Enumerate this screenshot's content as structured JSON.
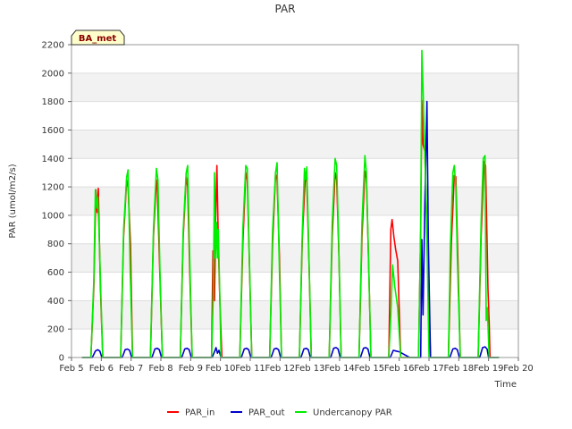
{
  "chart_data": {
    "type": "line",
    "title": "PAR",
    "xlabel": "Time",
    "ylabel": "PAR (umol/m2/s)",
    "badge": "BA_met",
    "xlim": [
      5,
      20
    ],
    "ylim": [
      0,
      2200
    ],
    "x_ticks": [
      5,
      6,
      7,
      8,
      9,
      10,
      11,
      12,
      13,
      14,
      15,
      16,
      17,
      18,
      19,
      20
    ],
    "x_tick_labels": [
      "Feb 5",
      "Feb 6",
      "Feb 7",
      "Feb 8",
      "Feb 9",
      "Feb 10",
      "Feb 11",
      "Feb 12",
      "Feb 13",
      "Feb 14",
      "Feb 15",
      "Feb 16",
      "Feb 17",
      "Feb 18",
      "Feb 19",
      "Feb 20"
    ],
    "y_ticks": [
      0,
      200,
      400,
      600,
      800,
      1000,
      1200,
      1400,
      1600,
      1800,
      2000,
      2200
    ],
    "y_tick_labels": [
      "0",
      "200",
      "400",
      "600",
      "800",
      "1000",
      "1200",
      "1400",
      "1600",
      "1800",
      "2000",
      "2200"
    ],
    "grid": true,
    "legend_position": "bottom",
    "series": [
      {
        "name": "PAR_in",
        "color": "#ff0000",
        "x": [
          5.35,
          5.65,
          5.75,
          5.82,
          5.86,
          5.9,
          5.97,
          6.05,
          6.35,
          6.65,
          6.75,
          6.85,
          6.9,
          6.98,
          7.05,
          7.35,
          7.65,
          7.75,
          7.85,
          7.88,
          7.95,
          8.05,
          8.35,
          8.65,
          8.75,
          8.85,
          8.9,
          8.97,
          9.05,
          9.35,
          9.7,
          9.75,
          9.8,
          9.84,
          9.88,
          9.93,
          9.98,
          10.05,
          10.35,
          10.65,
          10.75,
          10.85,
          10.9,
          10.98,
          11.05,
          11.35,
          11.65,
          11.75,
          11.85,
          11.9,
          11.98,
          12.05,
          12.35,
          12.65,
          12.75,
          12.85,
          12.9,
          12.98,
          13.05,
          13.35,
          13.65,
          13.75,
          13.85,
          13.9,
          13.98,
          14.05,
          14.35,
          14.65,
          14.75,
          14.85,
          14.9,
          14.98,
          15.05,
          15.35,
          15.65,
          15.72,
          15.76,
          15.82,
          15.88,
          15.95,
          16.05,
          16.2,
          16.35,
          16.65,
          16.72,
          16.76,
          16.8,
          16.86,
          16.95,
          17.05,
          17.35,
          17.65,
          17.75,
          17.85,
          17.9,
          17.97,
          18.05,
          18.35,
          18.65,
          18.75,
          18.85,
          18.9,
          18.94,
          18.98,
          19.02,
          19.05,
          19.35
        ],
        "y": [
          0,
          0,
          500,
          1180,
          1020,
          1190,
          500,
          0,
          0,
          0,
          850,
          1250,
          1200,
          800,
          0,
          0,
          0,
          850,
          1250,
          1200,
          700,
          0,
          0,
          0,
          850,
          1270,
          1200,
          600,
          0,
          0,
          0,
          750,
          400,
          1000,
          1350,
          800,
          400,
          0,
          0,
          0,
          800,
          1300,
          1250,
          600,
          0,
          0,
          0,
          800,
          1290,
          1250,
          700,
          0,
          0,
          0,
          850,
          1280,
          1240,
          600,
          0,
          0,
          0,
          850,
          1300,
          1250,
          700,
          0,
          0,
          0,
          850,
          1310,
          1260,
          600,
          0,
          0,
          0,
          900,
          970,
          850,
          760,
          680,
          0,
          0,
          0,
          0,
          900,
          1810,
          1500,
          1450,
          700,
          0,
          0,
          0,
          800,
          1280,
          1270,
          700,
          0,
          0,
          0,
          850,
          1380,
          1350,
          900,
          480,
          250,
          0,
          0
        ]
      },
      {
        "name": "PAR_out",
        "color": "#0000cc",
        "x": [
          5.35,
          5.7,
          5.8,
          5.88,
          5.95,
          6.02,
          6.35,
          6.7,
          6.8,
          6.88,
          6.95,
          7.02,
          7.35,
          7.7,
          7.8,
          7.88,
          7.95,
          8.02,
          8.35,
          8.7,
          8.8,
          8.88,
          8.95,
          9.02,
          9.35,
          9.72,
          9.8,
          9.85,
          9.9,
          9.95,
          10.02,
          10.35,
          10.7,
          10.8,
          10.88,
          10.95,
          11.02,
          11.35,
          11.7,
          11.8,
          11.88,
          11.95,
          12.02,
          12.35,
          12.7,
          12.8,
          12.88,
          12.95,
          13.02,
          13.35,
          13.7,
          13.8,
          13.88,
          13.95,
          14.02,
          14.35,
          14.7,
          14.8,
          14.88,
          14.95,
          15.02,
          15.35,
          15.7,
          15.8,
          15.9,
          16.0,
          16.35,
          16.72,
          16.76,
          16.8,
          16.86,
          16.93,
          16.98,
          17.05,
          17.35,
          17.7,
          17.8,
          17.88,
          17.95,
          18.02,
          18.35,
          18.7,
          18.8,
          18.88,
          18.95,
          19.0,
          19.35
        ],
        "y": [
          0,
          0,
          45,
          55,
          45,
          0,
          0,
          0,
          55,
          60,
          50,
          0,
          0,
          0,
          60,
          65,
          55,
          0,
          0,
          0,
          60,
          65,
          55,
          0,
          0,
          0,
          40,
          70,
          30,
          50,
          0,
          0,
          0,
          60,
          65,
          55,
          0,
          0,
          0,
          60,
          65,
          55,
          0,
          0,
          0,
          60,
          65,
          55,
          0,
          0,
          0,
          65,
          70,
          60,
          0,
          0,
          0,
          65,
          70,
          60,
          0,
          0,
          0,
          50,
          45,
          40,
          0,
          0,
          830,
          300,
          1050,
          1800,
          800,
          0,
          0,
          0,
          60,
          65,
          55,
          0,
          0,
          0,
          70,
          75,
          60,
          0,
          0
        ]
      },
      {
        "name": "Undercanopy PAR",
        "color": "#00ee00",
        "x": [
          5.35,
          5.65,
          5.75,
          5.8,
          5.85,
          5.88,
          5.92,
          6.0,
          6.05,
          6.35,
          6.65,
          6.75,
          6.85,
          6.9,
          6.97,
          7.05,
          7.35,
          7.65,
          7.75,
          7.85,
          7.9,
          7.97,
          8.05,
          8.35,
          8.65,
          8.75,
          8.85,
          8.9,
          8.97,
          9.05,
          9.35,
          9.7,
          9.76,
          9.8,
          9.83,
          9.87,
          9.9,
          9.93,
          9.97,
          10.02,
          10.35,
          10.65,
          10.75,
          10.85,
          10.9,
          10.97,
          11.05,
          11.35,
          11.65,
          11.75,
          11.85,
          11.9,
          11.97,
          12.05,
          12.35,
          12.65,
          12.75,
          12.82,
          12.86,
          12.9,
          12.97,
          13.05,
          13.35,
          13.65,
          13.75,
          13.85,
          13.9,
          13.97,
          14.05,
          14.35,
          14.65,
          14.75,
          14.85,
          14.9,
          14.97,
          15.05,
          15.35,
          15.65,
          15.72,
          15.78,
          15.85,
          15.95,
          16.05,
          16.35,
          16.65,
          16.72,
          16.76,
          16.8,
          16.85,
          16.92,
          17.0,
          17.35,
          17.65,
          17.72,
          17.8,
          17.85,
          17.9,
          17.95,
          18.05,
          18.35,
          18.65,
          18.75,
          18.82,
          18.88,
          18.92,
          18.96,
          19.02,
          19.35
        ],
        "y": [
          0,
          0,
          550,
          1180,
          1050,
          1130,
          900,
          350,
          0,
          0,
          0,
          900,
          1270,
          1320,
          600,
          0,
          0,
          0,
          900,
          1330,
          1250,
          600,
          0,
          0,
          0,
          900,
          1300,
          1350,
          700,
          0,
          0,
          0,
          450,
          1300,
          700,
          950,
          700,
          900,
          500,
          0,
          0,
          0,
          900,
          1350,
          1330,
          700,
          0,
          0,
          0,
          900,
          1300,
          1370,
          700,
          0,
          0,
          0,
          900,
          1330,
          1250,
          1340,
          700,
          0,
          0,
          0,
          950,
          1400,
          1350,
          800,
          0,
          0,
          0,
          950,
          1420,
          1300,
          700,
          0,
          0,
          0,
          300,
          650,
          500,
          350,
          0,
          0,
          0,
          900,
          2160,
          1900,
          1500,
          1000,
          0,
          0,
          0,
          800,
          1300,
          1350,
          1200,
          700,
          0,
          0,
          0,
          950,
          1400,
          1420,
          260,
          350,
          0,
          0
        ]
      }
    ]
  }
}
